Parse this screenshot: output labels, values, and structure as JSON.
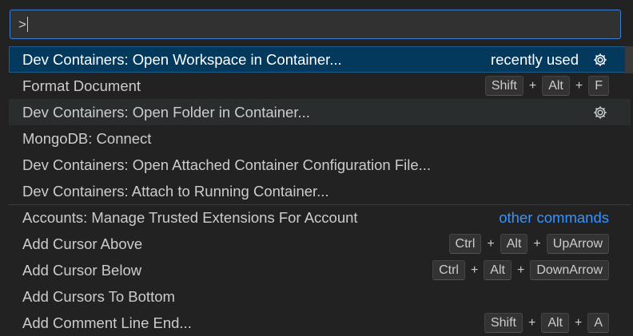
{
  "input": {
    "value": ">"
  },
  "rows": [
    {
      "label": "Dev Containers: Open Workspace in Container...",
      "badge": "recently used",
      "gear": true
    },
    {
      "label": "Format Document",
      "keys": [
        "Shift",
        "Alt",
        "F"
      ]
    },
    {
      "label": "Dev Containers: Open Folder in Container...",
      "gear": true
    },
    {
      "label": "MongoDB: Connect"
    },
    {
      "label": "Dev Containers: Open Attached Container Configuration File..."
    },
    {
      "label": "Dev Containers: Attach to Running Container..."
    },
    {
      "label": "Accounts: Manage Trusted Extensions For Account",
      "group": "other commands"
    },
    {
      "label": "Add Cursor Above",
      "keys": [
        "Ctrl",
        "Alt",
        "UpArrow"
      ]
    },
    {
      "label": "Add Cursor Below",
      "keys": [
        "Ctrl",
        "Alt",
        "DownArrow"
      ]
    },
    {
      "label": "Add Cursors To Bottom"
    },
    {
      "label": "Add Comment Line End...",
      "keys": [
        "Shift",
        "Alt",
        "A"
      ]
    }
  ],
  "key_separator": "+",
  "colors": {
    "selected_bg": "#04395e",
    "focus_border": "#3b7fd4",
    "link": "#3794ff"
  },
  "icons": {
    "gear": "gear-icon"
  }
}
